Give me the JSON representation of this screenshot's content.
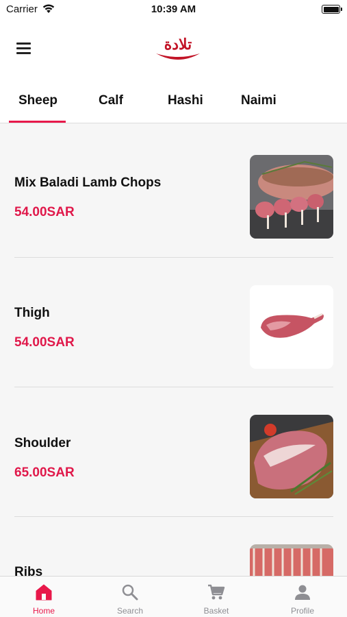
{
  "status_bar": {
    "carrier": "Carrier",
    "time": "10:39 AM"
  },
  "header": {
    "logo_text": "تلادة",
    "logo_color": "#c21427",
    "menu_icon": "hamburger-menu-icon"
  },
  "tabs": [
    {
      "label": "Sheep",
      "active": true
    },
    {
      "label": "Calf",
      "active": false
    },
    {
      "label": "Hashi",
      "active": false
    },
    {
      "label": "Naimi",
      "active": false
    }
  ],
  "accent_color": "#e8184a",
  "products": [
    {
      "name": "Mix Baladi Lamb Chops",
      "price": "54.00SAR",
      "image": "lamb-chops-photo"
    },
    {
      "name": "Thigh",
      "price": "54.00SAR",
      "image": "thigh-photo"
    },
    {
      "name": "Shoulder",
      "price": "65.00SAR",
      "image": "shoulder-photo"
    },
    {
      "name": "Ribs",
      "price": "",
      "image": "ribs-photo"
    }
  ],
  "bottom_nav": [
    {
      "label": "Home",
      "icon": "home-icon",
      "active": true
    },
    {
      "label": "Search",
      "icon": "search-icon",
      "active": false
    },
    {
      "label": "Basket",
      "icon": "cart-icon",
      "active": false
    },
    {
      "label": "Profile",
      "icon": "profile-icon",
      "active": false
    }
  ]
}
